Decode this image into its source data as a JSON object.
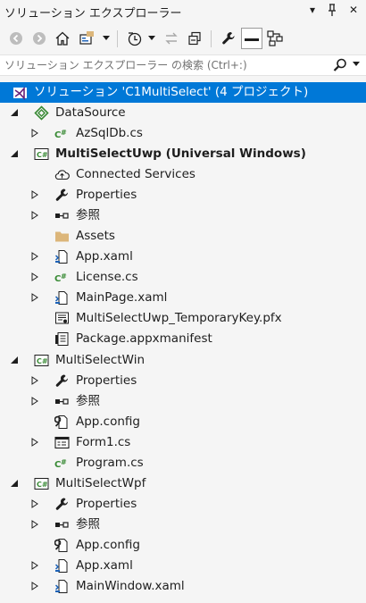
{
  "titlebar": {
    "title": "ソリューション エクスプローラー",
    "dropdown_glyph": "▾",
    "pin_glyph": "⊥",
    "close_glyph": "✕"
  },
  "search": {
    "placeholder": "ソリューション エクスプローラー の検索 (Ctrl+:)"
  },
  "tree": {
    "solution": {
      "label": "ソリューション 'C1MultiSelect' (4 プロジェクト)"
    },
    "datasource": {
      "label": "DataSource",
      "azsqldb": "AzSqlDb.cs"
    },
    "uwp": {
      "label": "MultiSelectUwp (Universal Windows)",
      "connected_services": "Connected Services",
      "properties": "Properties",
      "references": "参照",
      "assets": "Assets",
      "app_xaml": "App.xaml",
      "license": "License.cs",
      "mainpage": "MainPage.xaml",
      "pfx": "MultiSelectUwp_TemporaryKey.pfx",
      "manifest": "Package.appxmanifest"
    },
    "win": {
      "label": "MultiSelectWin",
      "properties": "Properties",
      "references": "参照",
      "app_config": "App.config",
      "form1": "Form1.cs",
      "program": "Program.cs"
    },
    "wpf": {
      "label": "MultiSelectWpf",
      "properties": "Properties",
      "references": "参照",
      "app_config": "App.config",
      "app_xaml": "App.xaml",
      "mainwindow": "MainWindow.xaml"
    }
  },
  "colors": {
    "selection": "#0078D7",
    "background": "#F5F5F5",
    "csharp_green": "#388A34",
    "datasource_green": "#388A34",
    "folder": "#DCB67A",
    "xaml_blue": "#1E63B8",
    "solution_purple": "#68217A"
  },
  "icons": {
    "solution": "visual-studio-solution-icon",
    "datasource": "datasource-diamond-icon",
    "csharp_file": "csharp-file-icon",
    "csharp_project": "csharp-project-icon",
    "connected_services": "cloud-icon",
    "properties": "wrench-icon",
    "references": "references-icon",
    "folder": "folder-icon",
    "xaml": "xaml-file-icon",
    "pfx": "certificate-icon",
    "manifest": "manifest-icon",
    "config": "config-file-icon",
    "form": "form-icon"
  }
}
